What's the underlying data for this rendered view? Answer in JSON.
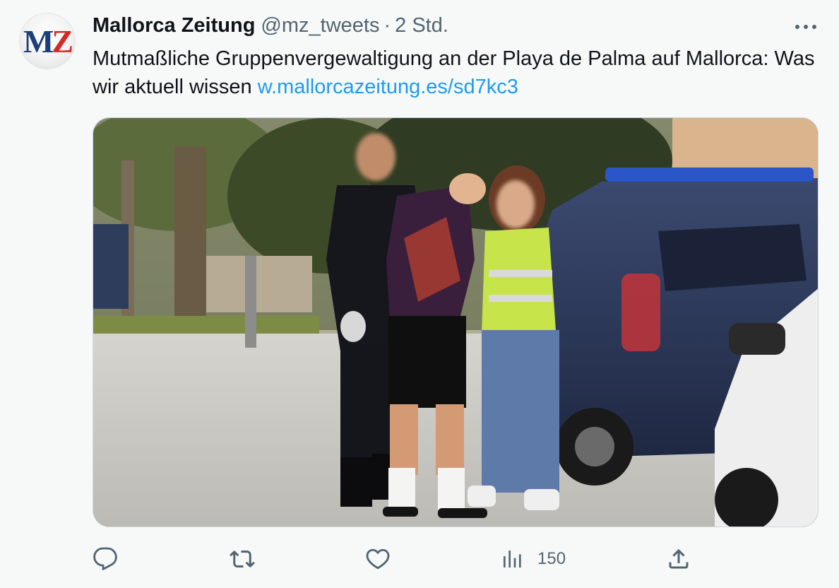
{
  "tweet": {
    "avatar": {
      "logo_m": "M",
      "logo_z": "Z"
    },
    "display_name": "Mallorca Zeitung",
    "handle": "@mz_tweets",
    "separator": "·",
    "time": "2 Std.",
    "text": "Mutmaßliche Gruppenvergewaltigung an der Playa de Palma auf Mallorca: Was wir aktuell wissen",
    "link_text": "w.mallorcazeitung.es/sd7kc3",
    "media_alt": "Police officers escorting a man with covered face to a police car"
  },
  "actions": {
    "reply_icon": "reply-icon",
    "retweet_icon": "retweet-icon",
    "like_icon": "heart-icon",
    "views_icon": "views-chart-icon",
    "views_count": "150",
    "share_icon": "share-icon"
  },
  "colors": {
    "background": "#f7f9f9",
    "text": "#0f1419",
    "secondary": "#536471",
    "link": "#1d9bf0",
    "brand_blue": "#1c3f7a",
    "brand_red": "#d42a26"
  }
}
